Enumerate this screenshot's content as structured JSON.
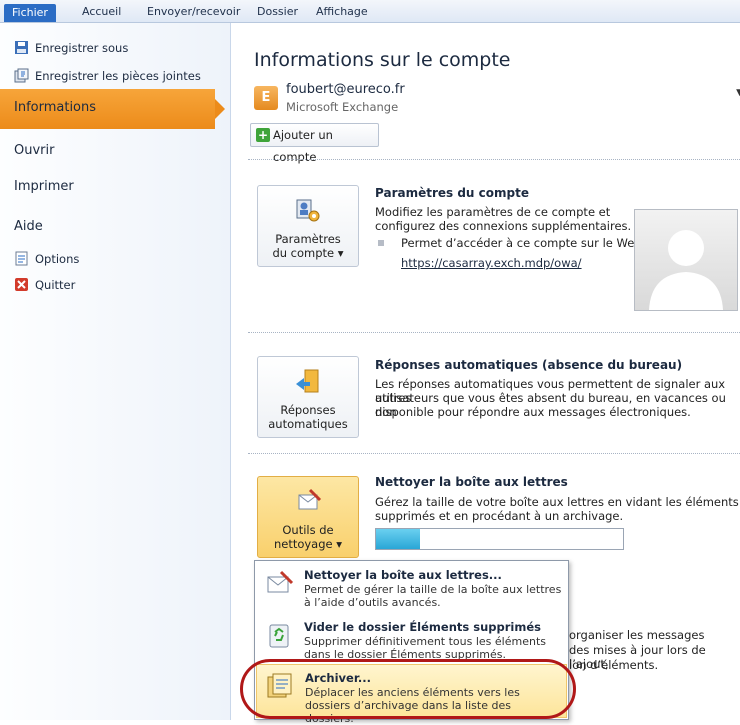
{
  "ribbon": {
    "tabs": [
      "Fichier",
      "Accueil",
      "Envoyer/recevoir",
      "Dossier",
      "Affichage"
    ]
  },
  "sidebar": {
    "save_as": "Enregistrer sous",
    "save_attachments": "Enregistrer les pièces jointes",
    "info": "Informations",
    "open": "Ouvrir",
    "print": "Imprimer",
    "help": "Aide",
    "options": "Options",
    "quit": "Quitter"
  },
  "main": {
    "title": "Informations sur le compte",
    "account": {
      "email": "foubert@eureco.fr",
      "type": "Microsoft Exchange",
      "logo": "E"
    },
    "add_account": "Ajouter un compte",
    "account_settings": {
      "button": [
        "Paramètres",
        "du compte ▾"
      ],
      "title": "Paramètres du compte",
      "text": [
        "Modifiez les paramètres de ce compte et",
        "configurez des connexions supplémentaires."
      ],
      "bullet": "Permet d’accéder à ce compte sur le Web.",
      "link": "https://casarray.exch.mdp/owa/"
    },
    "auto_replies": {
      "button": [
        "Réponses",
        "automatiques"
      ],
      "title": "Réponses automatiques (absence du bureau)",
      "text": [
        "Les réponses automatiques vous permettent de signaler aux autres",
        "utilisateurs que vous êtes absent du bureau, en vacances ou non",
        "disponible pour répondre aux messages électroniques."
      ]
    },
    "cleanup": {
      "button": [
        "Outils de",
        "nettoyage ▾"
      ],
      "title": "Nettoyer la boîte aux lettres",
      "text": [
        "Gérez la taille de votre boîte aux lettres en vidant les éléments",
        "supprimés et en procédant à un archivage."
      ],
      "progress": 0.18
    },
    "partial": [
      "organiser les messages",
      "des mises à jour lors de l’ajout,",
      "ion d’éléments."
    ]
  },
  "menu": {
    "items": [
      {
        "title": "Nettoyer la boîte aux lettres...",
        "desc": [
          "Permet de gérer la taille de la boîte aux lettres",
          "à l’aide d’outils avancés."
        ]
      },
      {
        "title": "Vider le dossier Éléments supprimés",
        "desc": [
          "Supprimer définitivement tous les éléments",
          "dans le dossier Éléments supprimés."
        ]
      },
      {
        "title": "Archiver...",
        "desc": [
          "Déplacer les anciens éléments vers les",
          "dossiers d’archivage dans la liste des dossiers."
        ]
      }
    ]
  },
  "colors": {
    "active": "#ec8b1a",
    "file_tab": "#2b6cc4",
    "highlight": "#b01818"
  }
}
